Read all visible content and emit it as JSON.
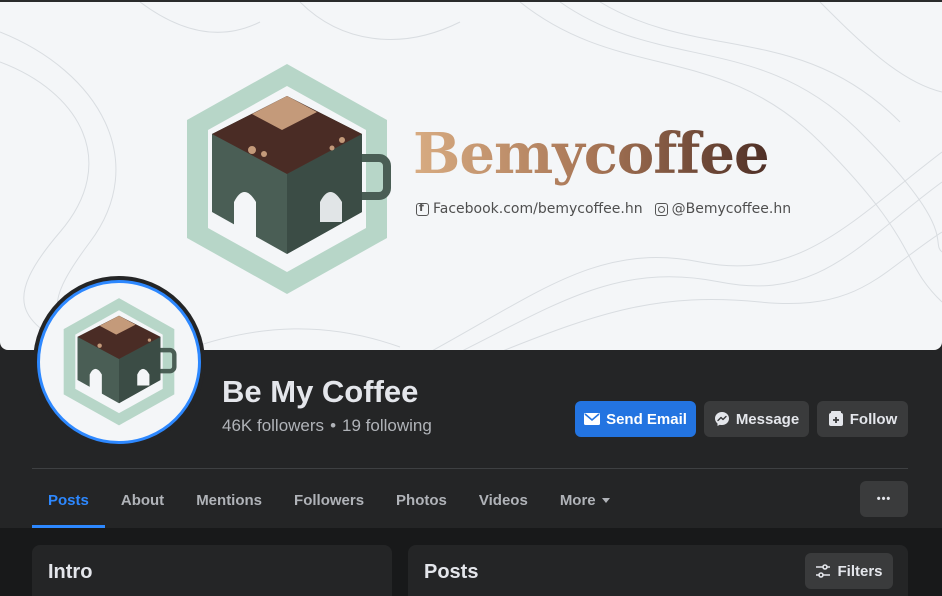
{
  "cover": {
    "brand_name": "Bemycoffee",
    "facebook_handle": "Facebook.com/bemycoffee.hn",
    "instagram_handle": "@Bemycoffee.hn"
  },
  "profile": {
    "name": "Be My Coffee",
    "followers": "46K followers",
    "separator": "•",
    "following": "19 following"
  },
  "actions": {
    "send_email": "Send Email",
    "message": "Message",
    "follow": "Follow"
  },
  "tabs": [
    {
      "label": "Posts",
      "active": true
    },
    {
      "label": "About"
    },
    {
      "label": "Mentions"
    },
    {
      "label": "Followers"
    },
    {
      "label": "Photos"
    },
    {
      "label": "Videos"
    },
    {
      "label": "More"
    }
  ],
  "more_button": "•••",
  "intro": {
    "title": "Intro"
  },
  "posts": {
    "title": "Posts",
    "filters_label": "Filters"
  },
  "colors": {
    "accent": "#2d88ff",
    "primary_button": "#2374e1",
    "surface": "#242526",
    "background": "#18191a",
    "logo_green": "#a8cfbe",
    "logo_dark": "#4a5e55",
    "coffee": "#4a2c25"
  }
}
